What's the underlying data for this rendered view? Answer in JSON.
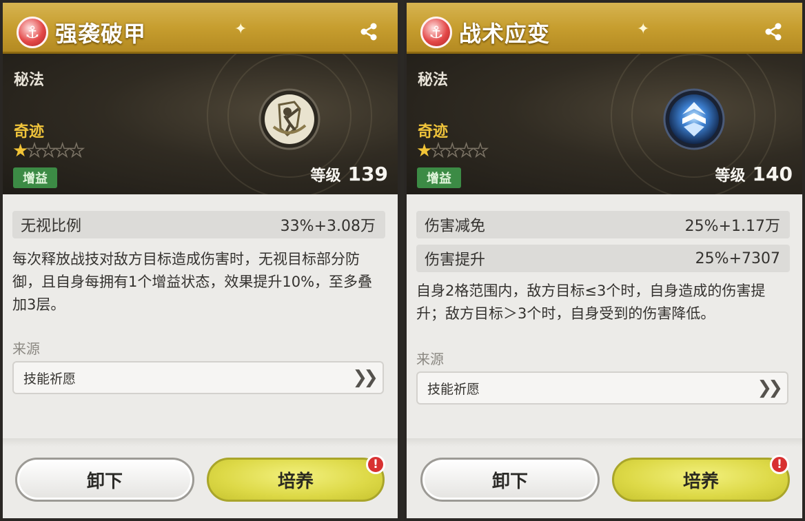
{
  "cards": [
    {
      "title": "强袭破甲",
      "category": "秘法",
      "rarity": "奇迹",
      "stars": 1,
      "max_stars": 5,
      "tag": "增益",
      "level_label": "等级",
      "level": "139",
      "stats": [
        {
          "name": "无视比例",
          "value": "33%+3.08万"
        }
      ],
      "description": "每次释放战技对敌方目标造成伤害时，无视目标部分防御，且自身每拥有1个增益状态，效果提升10%，至多叠加3层。",
      "source_label": "来源",
      "source_item": "技能祈愿",
      "unequip_label": "卸下",
      "train_label": "培养",
      "icon": "shield-sword-icon"
    },
    {
      "title": "战术应变",
      "category": "秘法",
      "rarity": "奇迹",
      "stars": 1,
      "max_stars": 5,
      "tag": "增益",
      "level_label": "等级",
      "level": "140",
      "stats": [
        {
          "name": "伤害减免",
          "value": "25%+1.17万"
        },
        {
          "name": "伤害提升",
          "value": "25%+7307"
        }
      ],
      "description": "自身2格范围内，敌方目标≤3个时，自身造成的伤害提升；敌方目标＞3个时，自身受到的伤害降低。",
      "source_label": "来源",
      "source_item": "技能祈愿",
      "unequip_label": "卸下",
      "train_label": "培养",
      "icon": "blue-chevron-emblem-icon"
    }
  ],
  "alert_badge": "!",
  "colors": {
    "title_gold": "#c69d2e",
    "rarity_gold": "#f0c43b",
    "tag_green": "#3c8b45",
    "train_yellow": "#ddd947",
    "alert_red": "#d83131"
  }
}
